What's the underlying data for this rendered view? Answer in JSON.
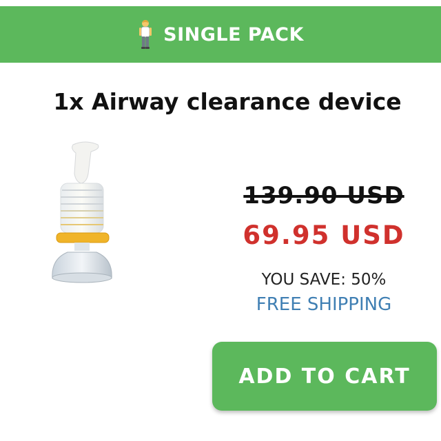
{
  "header": {
    "icon": "person-standing-icon",
    "title": "SINGLE PACK"
  },
  "product": {
    "title": "1x Airway clearance device",
    "image": "airway-clearance-device-image"
  },
  "pricing": {
    "original_price": "139.90 USD",
    "sale_price": "69.95 USD",
    "savings": "YOU SAVE: 50%",
    "shipping": "FREE SHIPPING"
  },
  "actions": {
    "add_to_cart_label": "ADD TO CART"
  },
  "colors": {
    "accent_green": "#5cb85c",
    "sale_red": "#d0312d",
    "shipping_blue": "#3f7fb3"
  }
}
